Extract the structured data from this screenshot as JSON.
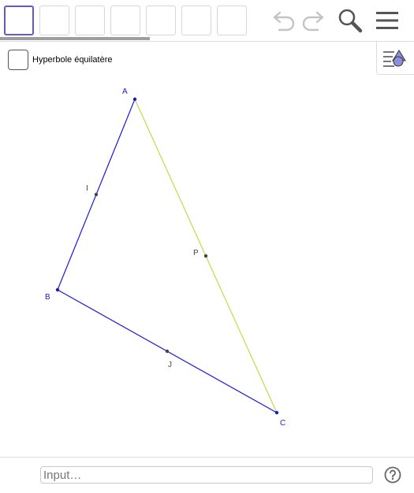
{
  "toolbar": {
    "tool_count": 7,
    "active_tool_index": 0,
    "icons": [
      "undo-icon",
      "redo-icon",
      "search-icon",
      "menu-icon"
    ]
  },
  "style_bar": {
    "icon": "graphics-style-icon"
  },
  "checkbox": {
    "label": "Hyperbole équilatère",
    "checked": false
  },
  "geometry": {
    "points": [
      {
        "name": "A",
        "label": "A",
        "color": "#1a1acc"
      },
      {
        "name": "B",
        "label": "B",
        "color": "#1a1acc"
      },
      {
        "name": "C",
        "label": "C",
        "color": "#1a1acc"
      },
      {
        "name": "I",
        "label": "I",
        "color": "#444444"
      },
      {
        "name": "J",
        "label": "J",
        "color": "#444444"
      },
      {
        "name": "P",
        "label": "P",
        "color": "#444444"
      }
    ],
    "segments": [
      {
        "from": "A",
        "to": "B",
        "color": "#1a1adb"
      },
      {
        "from": "B",
        "to": "C",
        "color": "#1a1adb"
      },
      {
        "from": "A",
        "to": "C",
        "color": "#c6d94a"
      }
    ]
  },
  "input_bar": {
    "placeholder": "Input…",
    "help_icon": "help-icon"
  }
}
